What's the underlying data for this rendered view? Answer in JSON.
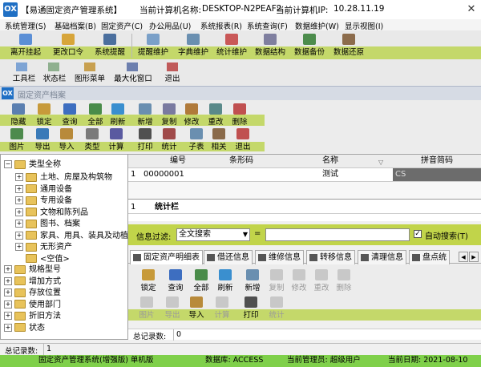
{
  "window": {
    "title": "【易通固定资产管理系统】",
    "computer_name_label": "当前计算机名称:",
    "computer_name": "DESKTOP-N2PEAF2",
    "ip_label": "当前计算机IP:",
    "ip": "10.28.11.19",
    "logo": "OX"
  },
  "menu": [
    "系统管理(S)",
    "基础档案(B)",
    "固定资产(C)",
    "办公用品(U)",
    "系统报表(R)",
    "系统查询(F)",
    "数据维护(W)",
    "显示视图(I)"
  ],
  "toolbar1": [
    "离开挂起",
    "更改口令",
    "系统提醒",
    "提醒维护",
    "字典维护",
    "统计维护",
    "数据结构",
    "数据备份",
    "数据还原"
  ],
  "toolbar2": [
    "工具栏",
    "状态栏",
    "图形菜单",
    "最大化窗口",
    "退出"
  ],
  "inner_window": {
    "title": "固定资产档案",
    "logo": "OX"
  },
  "inner_toolbar_row1": [
    "隐藏",
    "锁定",
    "查询",
    "全部",
    "刷新",
    "新增",
    "复制",
    "修改",
    "重改",
    "删除"
  ],
  "inner_toolbar_row2": [
    "图片",
    "导出",
    "导入",
    "类型",
    "计算",
    "打印",
    "统计",
    "子表",
    "相关",
    "退出"
  ],
  "tree": {
    "root": "类型全称",
    "children": [
      "土地、房屋及构筑物",
      "通用设备",
      "专用设备",
      "文物和陈列品",
      "图书、档案",
      "家具、用具、装具及动植",
      "无形资产",
      "<空值>"
    ],
    "others": [
      "规格型号",
      "增加方式",
      "存放位置",
      "使用部门",
      "折旧方法",
      "状态"
    ]
  },
  "grid": {
    "headers": [
      "编号",
      "条形码",
      "名称",
      "拼音简码"
    ],
    "rows": [
      {
        "num": "1",
        "code": "00000001",
        "barcode": "",
        "name": "测试",
        "pinyin": "CS"
      }
    ],
    "summary_num": "1",
    "summary_label": "统计栏"
  },
  "filter": {
    "label": "信息过滤:",
    "select": "全文搜索",
    "eq": "=",
    "auto_label": "自动搜索(T)"
  },
  "tabs": [
    "固定资产明细表",
    "借还信息",
    "维修信息",
    "转移信息",
    "清理信息",
    "盘点统"
  ],
  "sub_toolbar_row1": [
    "锁定",
    "查询",
    "全部",
    "刷新",
    "新增",
    "复制",
    "修改",
    "重改",
    "删除"
  ],
  "sub_toolbar_row2": [
    "图片",
    "导出",
    "导入",
    "计算",
    "打印",
    "统计"
  ],
  "sub_summary": {
    "label": "总记录数:",
    "value": "0"
  },
  "total_records": {
    "label": "总记录数:",
    "value": "1"
  },
  "statusbar": {
    "app": "固定资产管理系统(增强版) 单机版",
    "db": "数据库: ACCESS",
    "user": "当前管理员: 超级用户",
    "date": "当前日期: 2021-08-10"
  },
  "colors": {
    "accent_green": "#c4d86a",
    "titlebar_inner": "#d6dbe4",
    "filter_bg": "#c1d44a",
    "status_green": "#7fd04a"
  }
}
